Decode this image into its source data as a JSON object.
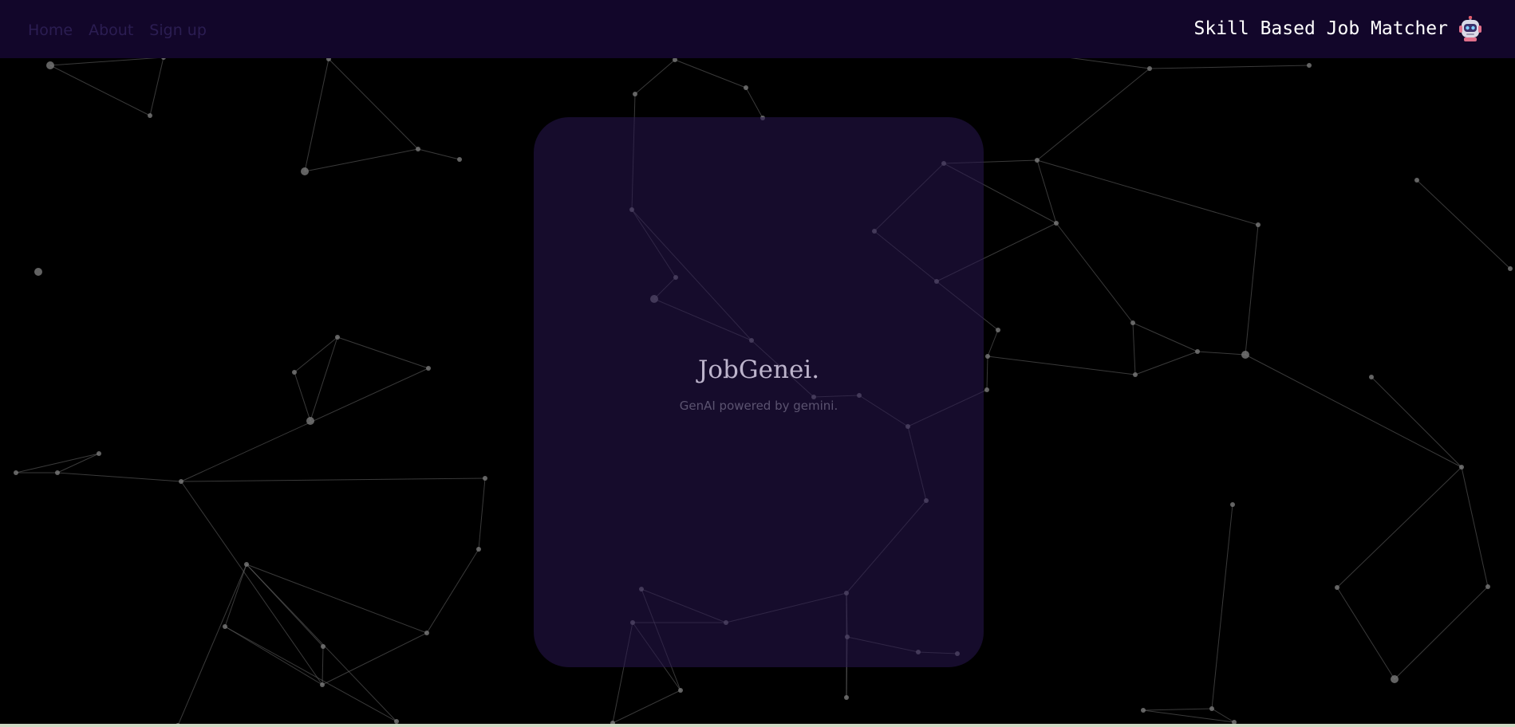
{
  "nav": {
    "links": [
      {
        "label": "Home"
      },
      {
        "label": "About"
      },
      {
        "label": "Sign up"
      }
    ],
    "brand_title": "Skill Based Job Matcher",
    "brand_icon": "robot-icon"
  },
  "hero": {
    "title": "JobGenei.",
    "subtitle": "GenAI powered by gemini."
  },
  "colors": {
    "background": "#000000",
    "navbar": "#12062a",
    "card": "#1c1033",
    "network_lines": "#6a6a6a",
    "nav_link": "#2b1d52"
  }
}
